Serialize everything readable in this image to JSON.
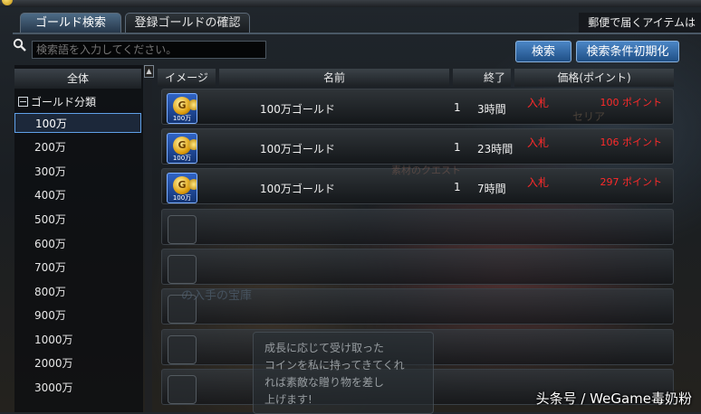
{
  "tabs": [
    "ゴールド検索",
    "登録ゴールドの確認"
  ],
  "notice": "郵便で届くアイテムは",
  "search": {
    "placeholder": "検索語を入力してください。",
    "button": "検索",
    "reset_button": "検索条件初期化"
  },
  "sidebar": {
    "all_label": "全体",
    "group_label": "ゴールド分類",
    "items": [
      "100万",
      "200万",
      "300万",
      "400万",
      "500万",
      "600万",
      "700万",
      "800万",
      "900万",
      "1000万",
      "2000万",
      "3000万"
    ],
    "selected": "100万"
  },
  "table": {
    "headers": {
      "image": "イメージ",
      "name": "名前",
      "end": "終了",
      "price": "価格(ポイント)"
    },
    "rows": [
      {
        "icon_caption": "100万",
        "name": "100万ゴールド",
        "qty": "1",
        "time": "3時間",
        "bid": "入札",
        "price": "100 ポイント"
      },
      {
        "icon_caption": "100万",
        "name": "100万ゴールド",
        "qty": "1",
        "time": "23時間",
        "bid": "入札",
        "price": "106 ポイント"
      },
      {
        "icon_caption": "100万",
        "name": "100万ゴールド",
        "qty": "1",
        "time": "7時間",
        "bid": "入札",
        "price": "297 ポイント"
      }
    ],
    "empty_rows": 5
  },
  "overlay": {
    "cerulia": "セリア",
    "faint": "素材のクエスト",
    "mid": "の入手の宝庫",
    "bubble_lines": [
      "成長に応じて受け取った",
      "コインを私に持ってきてくれ",
      "れば素敵な贈り物を差し",
      "上げます!"
    ]
  },
  "watermark": "头条号 / WeGame毒奶粉",
  "colors": {
    "accent": "#3a76bd",
    "price_red": "#ff2a2a",
    "coin_gold": "#e0a010"
  }
}
